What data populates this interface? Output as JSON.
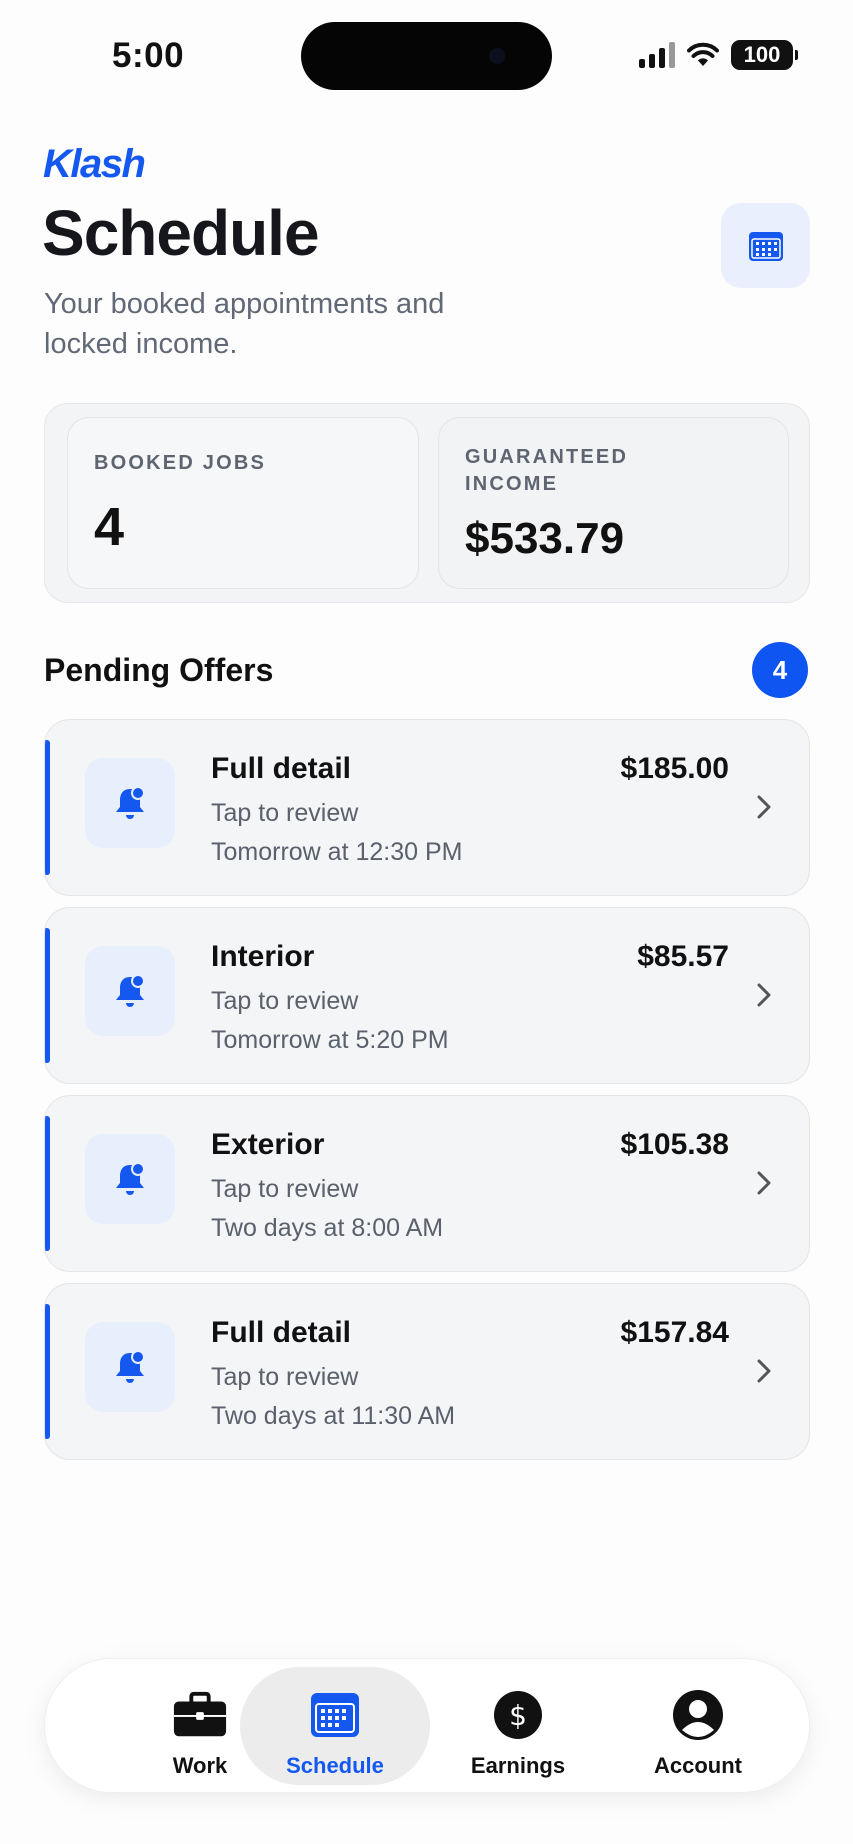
{
  "status_bar": {
    "time": "5:00",
    "battery": "100"
  },
  "header": {
    "brand": "Klash",
    "title": "Schedule",
    "subtitle": "Your booked appointments and locked income."
  },
  "stats": {
    "booked_label": "BOOKED JOBS",
    "booked_value": "4",
    "income_label": "GUARANTEED INCOME",
    "income_value": "$533.79"
  },
  "pending": {
    "title": "Pending Offers",
    "count": "4",
    "offers": [
      {
        "title": "Full detail",
        "subtitle": "Tap to review",
        "time": "Tomorrow at 12:30 PM",
        "price": "$185.00"
      },
      {
        "title": "Interior",
        "subtitle": "Tap to review",
        "time": "Tomorrow at 5:20 PM",
        "price": "$85.57"
      },
      {
        "title": "Exterior",
        "subtitle": "Tap to review",
        "time": "Two days at 8:00 AM",
        "price": "$105.38"
      },
      {
        "title": "Full detail",
        "subtitle": "Tap to review",
        "time": "Two days at 11:30 AM",
        "price": "$157.84"
      }
    ]
  },
  "tabs": [
    {
      "label": "Work",
      "icon": "briefcase-icon"
    },
    {
      "label": "Schedule",
      "icon": "calendar-icon",
      "active": true
    },
    {
      "label": "Earnings",
      "icon": "dollar-icon"
    },
    {
      "label": "Account",
      "icon": "person-icon"
    }
  ],
  "colors": {
    "accent": "#1458f0",
    "badge": "#0f55f2",
    "text_muted": "#5a606c"
  }
}
